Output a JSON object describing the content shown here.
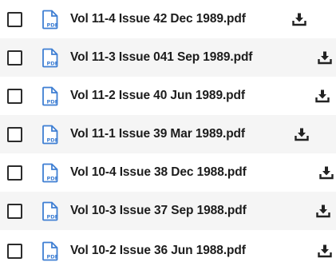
{
  "files": [
    {
      "name": "Vol 11-4 Issue 42 Dec 1989.pdf",
      "checked": false,
      "icon": "pdf-file-icon",
      "action_icon": "download-icon"
    },
    {
      "name": "Vol 11-3 Issue 041 Sep 1989.pdf",
      "checked": false,
      "icon": "pdf-file-icon",
      "action_icon": "download-icon"
    },
    {
      "name": "Vol 11-2 Issue 40 Jun 1989.pdf",
      "checked": false,
      "icon": "pdf-file-icon",
      "action_icon": "download-icon"
    },
    {
      "name": "Vol 11-1 Issue 39 Mar 1989.pdf",
      "checked": false,
      "icon": "pdf-file-icon",
      "action_icon": "download-icon"
    },
    {
      "name": "Vol 10-4 Issue 38 Dec 1988.pdf",
      "checked": false,
      "icon": "pdf-file-icon",
      "action_icon": "download-icon"
    },
    {
      "name": "Vol 10-3 Issue 37 Sep 1988.pdf",
      "checked": false,
      "icon": "pdf-file-icon",
      "action_icon": "download-icon"
    },
    {
      "name": "Vol 10-2 Issue 36 Jun 1988.pdf",
      "checked": false,
      "icon": "pdf-file-icon",
      "action_icon": "download-icon"
    }
  ],
  "icon_text": "PDF",
  "colors": {
    "pdf_icon": "#3f7fd3",
    "text": "#1c1c1c",
    "row_shade": "#f5f5f5",
    "download_icon": "#222222"
  }
}
